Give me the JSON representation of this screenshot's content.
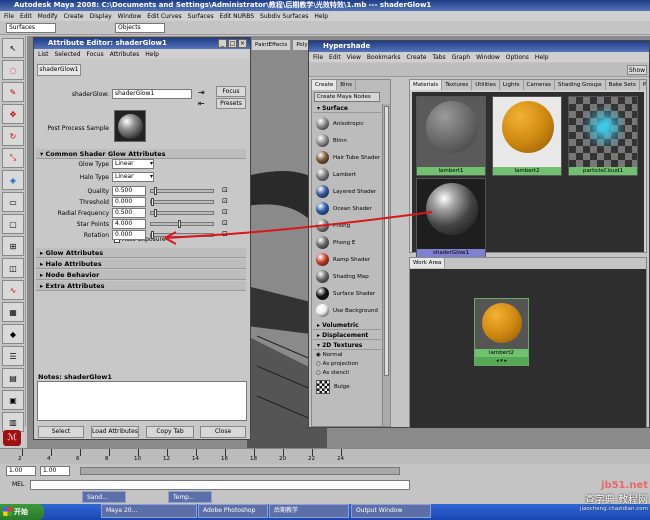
{
  "maya": {
    "title": "Autodesk Maya 2008: C:\\Documents and Settings\\Administrator\\教程\\后期教学\\光效特效\\1.mb  ---  shaderGlow1",
    "menu": [
      "File",
      "Edit",
      "Modify",
      "Create",
      "Display",
      "Window",
      "Edit Curves",
      "Surfaces",
      "Edit NURBS",
      "Subdiv Surfaces",
      "Help"
    ],
    "mode_select": "Surfaces",
    "objects_label": "Objects",
    "shelf_tabs": [
      "PaintEffects",
      "Polyg"
    ]
  },
  "attr_editor": {
    "title": "Attribute Editor: shaderGlow1",
    "menu": [
      "List",
      "Selected",
      "Focus",
      "Attributes",
      "Help"
    ],
    "tab": "shaderGlow1",
    "shader_label": "shaderGlow:",
    "shader_value": "shaderGlow1",
    "focus": "Focus",
    "presets": "Presets",
    "sample_label": "Post Process Sample",
    "common_section": "Common Shader Glow Attributes",
    "glow_type_label": "Glow Type",
    "glow_type": "Linear",
    "halo_type_label": "Halo Type",
    "halo_type": "Linear",
    "attrs": [
      {
        "label": "Quality",
        "value": "0.500",
        "level": 0.05
      },
      {
        "label": "Threshold",
        "value": "0.000",
        "level": 0.0
      },
      {
        "label": "Radial Frequency",
        "value": "0.500",
        "level": 0.05
      },
      {
        "label": "Star Points",
        "value": "4.000",
        "level": 0.45
      },
      {
        "label": "Rotation",
        "value": "0.000",
        "level": 0.0
      }
    ],
    "auto_exposure": "Auto Exposure",
    "sections": [
      "Glow Attributes",
      "Halo Attributes",
      "Node Behavior",
      "Extra Attributes"
    ],
    "notes_label": "Notes:  shaderGlow1",
    "buttons": [
      "Select",
      "Load Attributes",
      "Copy Tab",
      "Close"
    ]
  },
  "hypershade": {
    "title": "Hypershade",
    "menu": [
      "File",
      "Edit",
      "View",
      "Bookmarks",
      "Create",
      "Tabs",
      "Graph",
      "Window",
      "Options",
      "Help"
    ],
    "show": "Show",
    "left_tabs": [
      "Create",
      "Bins"
    ],
    "create_header": "Create Maya Nodes",
    "surface_header": "Surface",
    "nodes": [
      {
        "label": "Anisotropic",
        "color": "#8a8a8a"
      },
      {
        "label": "Blinn",
        "color": "#8e8e8e"
      },
      {
        "label": "Hair Tube Shader",
        "color": "#7a5a3a"
      },
      {
        "label": "Lambert",
        "color": "#808080"
      },
      {
        "label": "Layered Shader",
        "color": "#3a5a9a"
      },
      {
        "label": "Ocean Shader",
        "color": "#2a5aa8"
      },
      {
        "label": "Phong",
        "color": "#7a7a7a"
      },
      {
        "label": "Phong E",
        "color": "#6a6a6a"
      },
      {
        "label": "Ramp Shader",
        "color": "#c83c2a"
      },
      {
        "label": "Shading Map",
        "color": "#6a6a6a"
      },
      {
        "label": "Surface Shader",
        "color": "#111111"
      },
      {
        "label": "Use Background",
        "color": "#eeeeee"
      }
    ],
    "more_sections": [
      "Volumetric",
      "Displacement",
      "2D Textures"
    ],
    "radios": [
      "Normal",
      "As projection",
      "As stencil"
    ],
    "bulge": "Bulge",
    "top_tabs": [
      "Materials",
      "Textures",
      "Utilities",
      "Lights",
      "Cameras",
      "Shading Groups",
      "Bake Sets",
      "Projects"
    ],
    "swatches": [
      {
        "label": "lambert1",
        "type": "grey"
      },
      {
        "label": "lambert2",
        "type": "orange"
      },
      {
        "label": "particleCloud1",
        "type": "cloud"
      },
      {
        "label": "shaderGlow1",
        "type": "glow"
      }
    ],
    "work_area_tab": "Work Area",
    "work_node": "lambert2"
  },
  "timeline": {
    "ticks": [
      "2",
      "4",
      "6",
      "8",
      "10",
      "12",
      "14",
      "16",
      "18",
      "20",
      "22",
      "24"
    ],
    "start": "1.00",
    "cur": "1.00",
    "mel": "MEL"
  },
  "watermark": {
    "line1": "jb51.net",
    "line2": "查字典 教程网",
    "line3": "jiaocheng.chazidian.com"
  },
  "taskbar": {
    "start": "开始",
    "items": [
      "Mayа 20...",
      "Adobe Photoshop",
      "后期教学",
      "Output Window"
    ],
    "small": [
      "Sand...",
      "Temp..."
    ]
  }
}
